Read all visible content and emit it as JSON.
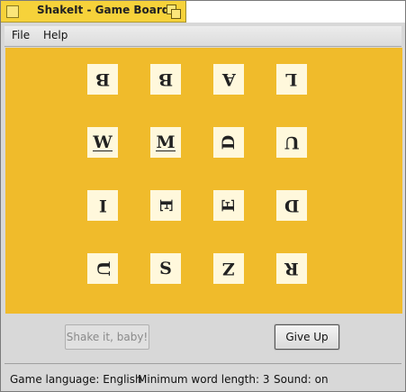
{
  "window": {
    "title": "ShakeIt - Game Board"
  },
  "menu": {
    "file": "File",
    "help": "Help"
  },
  "board": {
    "background": "#f0bb2b",
    "tiles": [
      {
        "letter": "B",
        "orientation": "upside-down"
      },
      {
        "letter": "B",
        "orientation": "upside-down"
      },
      {
        "letter": "A",
        "orientation": "upside-down"
      },
      {
        "letter": "L",
        "orientation": "upside-down"
      },
      {
        "letter": "W",
        "orientation": "upright",
        "underlined": true
      },
      {
        "letter": "M",
        "orientation": "upright",
        "underlined": true
      },
      {
        "letter": "D",
        "orientation": "rotated-left"
      },
      {
        "letter": "U",
        "orientation": "upside-down"
      },
      {
        "letter": "I",
        "orientation": "upside-down"
      },
      {
        "letter": "E",
        "orientation": "rotated-right"
      },
      {
        "letter": "E",
        "orientation": "rotated-left"
      },
      {
        "letter": "D",
        "orientation": "upside-down"
      },
      {
        "letter": "U",
        "orientation": "rotated-right"
      },
      {
        "letter": "S",
        "orientation": "upright"
      },
      {
        "letter": "Z",
        "orientation": "upside-down"
      },
      {
        "letter": "R",
        "orientation": "upside-down"
      }
    ]
  },
  "buttons": {
    "shake": "Shake it, baby!",
    "give_up": "Give Up"
  },
  "status": {
    "language": "Game language: English",
    "min_length": "Minimum word length: 3",
    "sound": "Sound: on"
  }
}
